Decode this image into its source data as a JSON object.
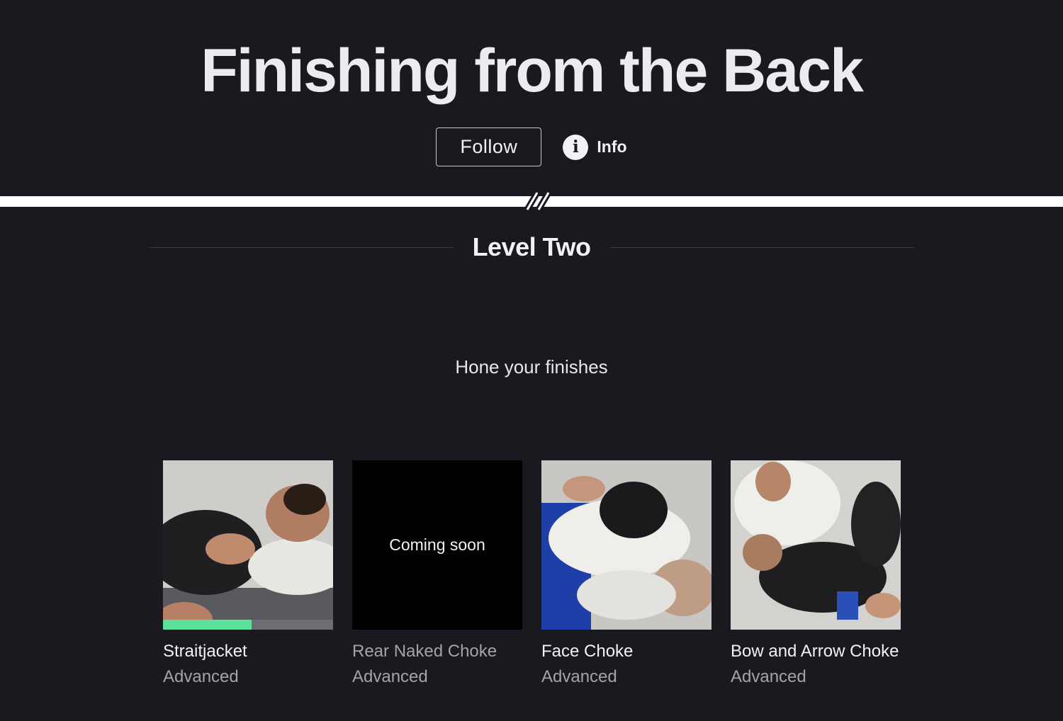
{
  "header": {
    "title": "Finishing from the Back",
    "follow_label": "Follow",
    "info_label": "Info",
    "info_icon": "info-icon"
  },
  "section": {
    "title": "Level Two",
    "subtitle": "Hone your finishes"
  },
  "colors": {
    "background": "#1a191f",
    "progress": "#5ce09b",
    "divider": "#ffffff"
  },
  "cards": [
    {
      "title": "Straitjacket",
      "level": "Advanced",
      "thumbnail": "grappling-photo",
      "progress_fraction": 0.52,
      "available": true
    },
    {
      "title": "Rear Naked Choke",
      "level": "Advanced",
      "overlay_text": "Coming soon",
      "available": false
    },
    {
      "title": "Face Choke",
      "level": "Advanced",
      "thumbnail": "grappling-photo",
      "available": true
    },
    {
      "title": "Bow and Arrow Choke",
      "level": "Advanced",
      "thumbnail": "grappling-photo",
      "available": true
    }
  ]
}
